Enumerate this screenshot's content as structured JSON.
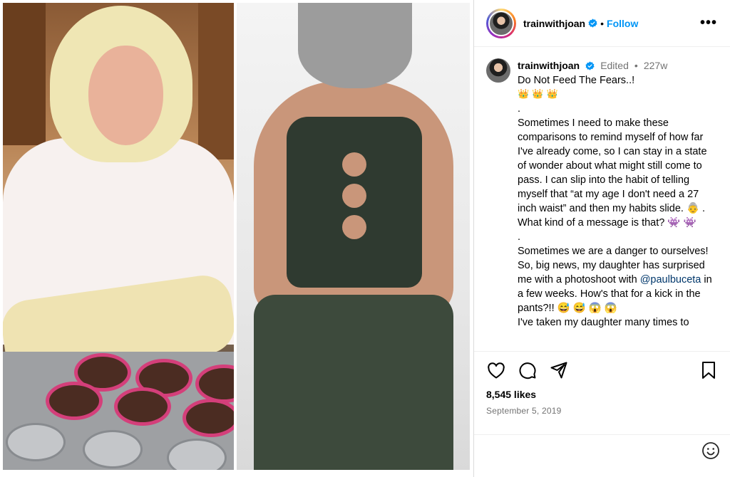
{
  "post": {
    "username": "trainwithjoan",
    "follow_label": "Follow",
    "separator": "•",
    "more_label": "•••",
    "edited_label": "Edited",
    "time_ago": "227w",
    "caption_lines": [
      "Do Not Feed The Fears..!",
      "👑 👑 👑",
      ".",
      "Sometimes I need to make these comparisons to remind myself of how far I've already come, so I can stay in a state of wonder about what might still come to pass. I can slip into the habit of telling myself that “at my age I don't need a 27 inch waist” and then my habits slide. 👵 .",
      "What kind of a message is that? 👾 👾",
      ".",
      "Sometimes we are a danger to ourselves!",
      "So, big news, my daughter has surprised me with a photoshoot with"
    ],
    "mention": "@paulbuceta",
    "after_mention": " in a few weeks. How's that for a kick in the pants?!! 😅 😅 😱 😱",
    "last_line": "I've taken my daughter many times to",
    "likes": "8,545 likes",
    "date": "September 5, 2019"
  },
  "icons": {
    "like": "heart-icon",
    "comment": "comment-icon",
    "share": "share-icon",
    "save": "bookmark-icon",
    "emoji": "smiley-icon",
    "verified": "verified-badge-icon"
  },
  "colors": {
    "follow": "#0095f6",
    "meta": "#737373",
    "mention": "#00376b",
    "verified": "#0095f6"
  }
}
